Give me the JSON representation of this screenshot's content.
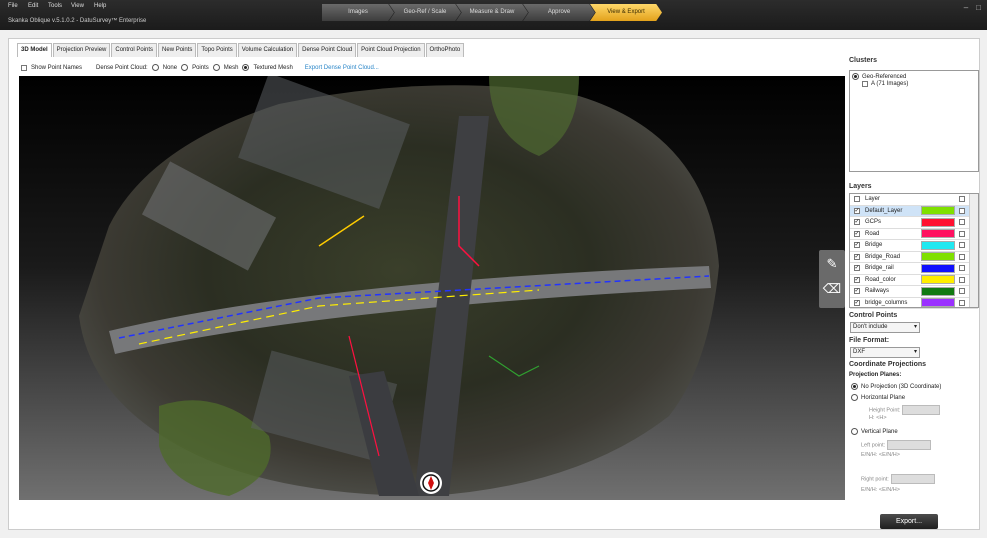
{
  "menu": [
    "File",
    "Edit",
    "Tools",
    "View",
    "Help"
  ],
  "app_title": "Skanka Oblique v.5.1.0.2 - DatuSurvey™ Enterprise",
  "workflow": [
    "Images",
    "Geo-Ref / Scale",
    "Measure & Draw",
    "Approve",
    "View & Export"
  ],
  "workflow_active": "View & Export",
  "window_buttons": [
    "–",
    "□"
  ],
  "tabs": [
    "3D Model",
    "Projection Preview",
    "Control Points",
    "New Points",
    "Topo Points",
    "Volume Calculation",
    "Dense Point Cloud",
    "Point Cloud Projection",
    "OrthoPhoto"
  ],
  "options": {
    "show_point_names": "Show Point Names",
    "dense_label": "Dense Point Cloud:",
    "radios": [
      "None",
      "Points",
      "Mesh",
      "Textured Mesh"
    ],
    "selected": "Textured Mesh",
    "export_link": "Export Dense Point Cloud..."
  },
  "clusters": {
    "title": "Clusters",
    "root": "Geo-Referenced",
    "child": "A (71 Images)"
  },
  "layers": {
    "title": "Layers",
    "header": "Layer",
    "rows": [
      {
        "name": "Default_Layer",
        "color": "#7fe000",
        "checked": true,
        "selected": true
      },
      {
        "name": "GCPs",
        "color": "#ff1030",
        "checked": true
      },
      {
        "name": "Road",
        "color": "#ff1060",
        "checked": true
      },
      {
        "name": "Bridge",
        "color": "#20e8f0",
        "checked": true
      },
      {
        "name": "Bridge_Road",
        "color": "#7fe000",
        "checked": true
      },
      {
        "name": "Bridge_rail",
        "color": "#1010ff",
        "checked": true
      },
      {
        "name": "Road_color",
        "color": "#ffee00",
        "checked": true
      },
      {
        "name": "Railways",
        "color": "#127a12",
        "checked": true
      },
      {
        "name": "bridge_columns",
        "color": "#9b30ff",
        "checked": true
      }
    ]
  },
  "control_points": {
    "label": "Control Points",
    "value": "Don't include"
  },
  "file_format": {
    "label": "File Format:",
    "value": "DXF"
  },
  "projections": {
    "title": "Coordinate Projections",
    "planes_label": "Projection Planes:",
    "opt_none": "No Projection (3D Coordinate)",
    "opt_horizontal": "Horizontal Plane",
    "height_point": "Height Point:",
    "h_label": "H:",
    "h_value": "<H>",
    "opt_vertical": "Vertical Plane",
    "left_point": "Left point:",
    "right_point": "Right point:",
    "enh_label": "E/N/H:",
    "enh_value": "<E/N/H>"
  },
  "export_button": "Export..."
}
